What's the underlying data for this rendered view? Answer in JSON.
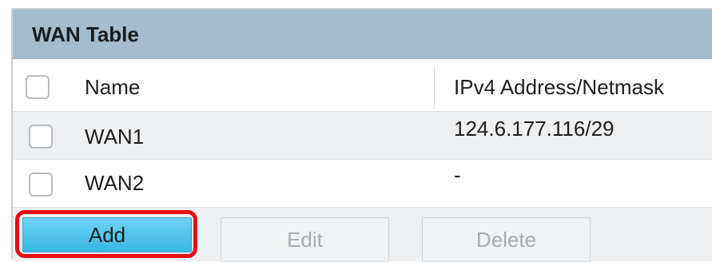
{
  "table": {
    "title": "WAN Table",
    "columns": [
      "Name",
      "IPv4 Address/Netmask"
    ],
    "rows": [
      {
        "name": "WAN1",
        "ipv4": "124.6.177.116/29"
      },
      {
        "name": "WAN2",
        "ipv4": "-"
      }
    ]
  },
  "buttons": {
    "add": "Add",
    "edit": "Edit",
    "delete": "Delete"
  },
  "colors": {
    "title_bar": "#a5bccc",
    "add_button": "#36b7e6",
    "highlight": "#e60f16"
  }
}
